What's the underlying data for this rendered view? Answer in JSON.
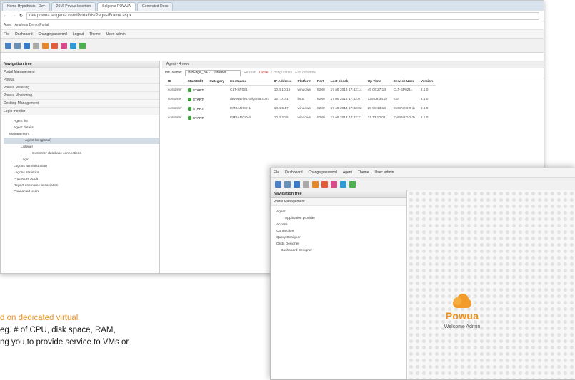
{
  "browser": {
    "tabs": [
      "Home Hypothesis - Dev",
      "2016 Powua Insertion",
      "Solgenia POWUA",
      "Generated Docs"
    ],
    "active_tab": 2,
    "url": "dev.powua.solgenia.com/Portal/ds/Pages/Frame.aspx"
  },
  "bookmarks": {
    "apps": "Apps",
    "portal": "Analysis Demo Portal"
  },
  "menu": {
    "file": "File",
    "dashboard": "Dashboard",
    "change_password": "Change password",
    "logout": "Logout",
    "theme": "Theme",
    "user": "User: admin"
  },
  "nav": {
    "title": "Navigation tree",
    "accordion": [
      "Portal Management",
      "Powua",
      "Powua Metering",
      "Powua Monitoring",
      "Desktop Management",
      "Login monitor"
    ],
    "tree": [
      "Agent list",
      "Agent details",
      "Management",
      "Agent list (global)",
      "Listener",
      "Customer database connections",
      "Login",
      "Logons administration",
      "Logons statistics",
      "Procedure Audit",
      "Report username association",
      "Connected users"
    ]
  },
  "content": {
    "header": "Agent - 4 rows",
    "filter_label": "Intl. Name:",
    "filter_value": "BizEdge_B4 - Customer",
    "filter_actions": [
      "Refresh",
      "Close",
      "Configuration",
      "Edit columns"
    ],
    "columns": [
      "ID",
      "Start/Edit",
      "Category",
      "Hostname",
      "IP Address",
      "Platform",
      "Port",
      "Last check",
      "Up Time",
      "Service User",
      "Version"
    ],
    "rows": [
      [
        "customer",
        "START",
        "",
        "CLT-SP021",
        "10.4.10.15",
        "windows",
        "8280",
        "17 ott 2014 17:42:14",
        "45 09:27:13",
        "CLT-SP021\\",
        "6.1.0"
      ],
      [
        "customer",
        "START",
        "",
        "dev.watrivo.solgenia.com",
        "127.0.0.1",
        "linux",
        "8280",
        "17 ott 2014 17:42:07",
        "125 09:34:27",
        "root",
        "6.1.0"
      ],
      [
        "customer",
        "START",
        "",
        "EMBARGO-1",
        "10.4.5.17",
        "windows",
        "8280",
        "17 ott 2014 17:42:02",
        "26 08:13:18",
        "EMBARGO-1\\",
        "6.1.0"
      ],
      [
        "customer",
        "START",
        "",
        "EMBARGO-3",
        "10.4.20.5",
        "windows",
        "8280",
        "17 ott 2014 17:42:21",
        "11 13:10:01",
        "EMBARGO-3\\",
        "6.1.0"
      ]
    ]
  },
  "article_text": [
    "d on dedicated virtual",
    "eg. # of CPU, disk space, RAM,",
    "ng you to provide service to VMs or"
  ],
  "window2": {
    "menu": [
      "File",
      "Dashboard",
      "Change password",
      "Agent",
      "Theme",
      "User: admin"
    ],
    "nav_title": "Navigation tree",
    "portal_management": "Portal Management",
    "tree": [
      "Agent",
      "Application provider",
      "Access",
      "Connection",
      "Query Designer",
      "Grids Designer",
      "Dashboard Designer"
    ],
    "brand": "Powua",
    "welcome": "Welcome Admin"
  },
  "colors": {
    "accent_orange": "#f0921c",
    "start_green": "#3ca33c"
  }
}
